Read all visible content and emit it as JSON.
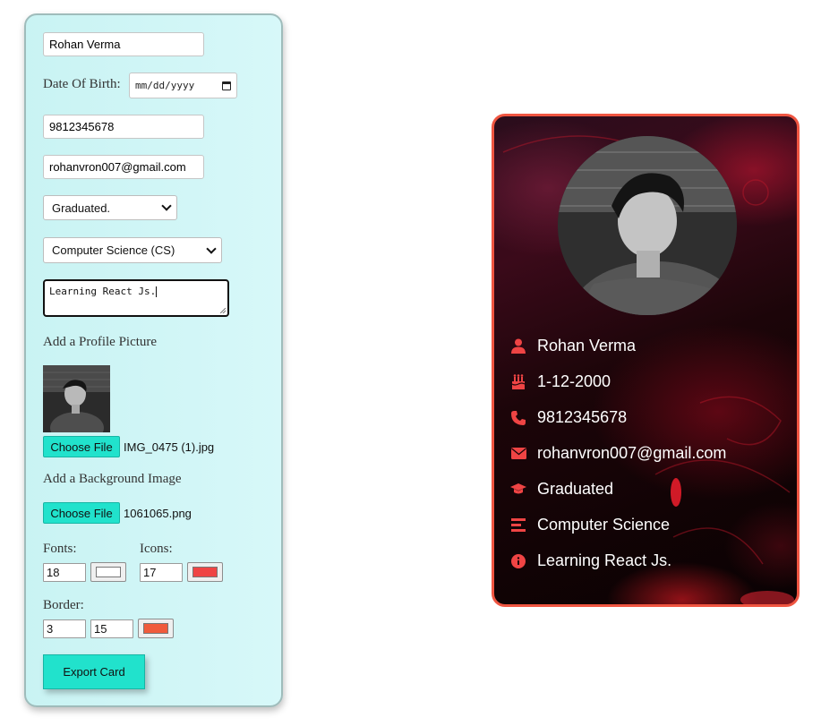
{
  "form": {
    "name_value": "Rohan Verma",
    "dob_label": "Date Of Birth:",
    "dob_placeholder": "mm/dd/yyyy",
    "phone_value": "9812345678",
    "email_value": "rohanvron007@gmail.com",
    "education_selected": "Graduated.",
    "branch_selected": "Computer Science (CS)",
    "note_value": "Learning React Js.",
    "profile_pic_label": "Add a Profile Picture",
    "profile_choose_label": "Choose File",
    "profile_file_name": "IMG_0475 (1).jpg",
    "background_label": "Add a Background Image",
    "background_choose_label": "Choose File",
    "background_file_name": "1061065.png",
    "fonts_label": "Fonts:",
    "fonts_size": "18",
    "fonts_color": "#ffffff",
    "icons_label": "Icons:",
    "icons_size": "17",
    "icons_color": "#ef4444",
    "border_label": "Border:",
    "border_width": "3",
    "border_radius": "15",
    "border_color": "#f05a3c",
    "export_label": "Export Card"
  },
  "card": {
    "name": "Rohan Verma",
    "dob": "1-12-2000",
    "phone": "9812345678",
    "email": "rohanvron007@gmail.com",
    "education": "Graduated",
    "branch": "Computer Science",
    "note": "Learning React Js.",
    "border_color": "#ef5541",
    "icon_color": "#ef4444",
    "icons": [
      "user-icon",
      "birthday-cake-icon",
      "phone-icon",
      "envelope-icon",
      "graduation-cap-icon",
      "list-icon",
      "info-icon"
    ]
  }
}
